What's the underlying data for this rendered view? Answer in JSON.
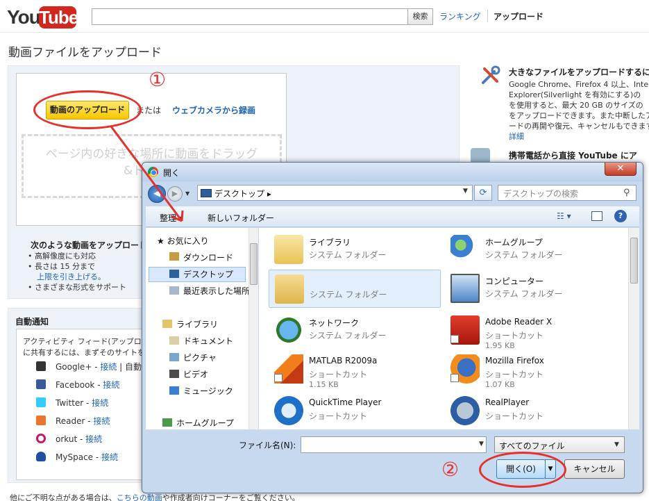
{
  "header": {
    "logo_you": "You",
    "logo_tube": "Tube",
    "search_value": "",
    "search_button": "検索",
    "nav_ranking": "ランキング",
    "nav_upload": "アップロード"
  },
  "page_title": "動画ファイルをアップロード",
  "upload": {
    "button": "動画のアップロード",
    "or_text": "または",
    "webcam_link": "ウェブカメラから録画",
    "drop_hint_line1": "ページ内の好きな場所に動画をドラッグ",
    "drop_hint_line2": "&ドロップ"
  },
  "requirements": {
    "title": "次のような動画をアップロード",
    "items": [
      "• 高解像度にも対応",
      "• 長さは 15 分まで",
      "上限を引き上げる。",
      "• さまざまな形式をサポート"
    ]
  },
  "notify": {
    "title": "自動通知",
    "desc_line1": "アクティビティ フィード(アップロード",
    "desc_line2": "に共有するには、まずそのサイトを",
    "services": [
      {
        "name": "Google+",
        "sep": " - ",
        "action": "接続",
        "extra": " | 自動通",
        "color": "#333333"
      },
      {
        "name": "Facebook",
        "sep": " - ",
        "action": "接続",
        "extra": "",
        "color": "#3b5998"
      },
      {
        "name": "Twitter",
        "sep": " - ",
        "action": "接続",
        "extra": "",
        "color": "#33ccff"
      },
      {
        "name": "Reader",
        "sep": " - ",
        "action": "接続",
        "extra": "",
        "color": "#e8762d"
      },
      {
        "name": "orkut",
        "sep": " - ",
        "action": "接続",
        "extra": "",
        "color": "#c4176c"
      },
      {
        "name": "MySpace",
        "sep": " - ",
        "action": "接続",
        "extra": "",
        "color": "#1e4fa1"
      }
    ]
  },
  "footer": {
    "prefix": "他にご不明な点がある場合は、",
    "link": "こちらの動画",
    "suffix": "や作成者向けコーナーをご覧ください。"
  },
  "tips": {
    "large_title": "大きなファイルをアップロードするに",
    "large_body": [
      "Google Chrome、Firefox 4 以上、Inter",
      "Explorer(Silverlight を有効にする)の",
      "を使用すると、最大 20 GB のサイズの",
      "をアップロードできます。また中断したア",
      "ードの再開や復元、キャンセルもできます",
      "詳細"
    ],
    "mobile_title": "携帯電話から直接 YouTube にア"
  },
  "annotations": {
    "step1": "①",
    "step2": "②"
  },
  "dialog": {
    "title": "開く",
    "close": "✕",
    "address": "デスクトップ ▸",
    "search_placeholder": "デスクトップの検索",
    "toolbar_organize": "整理 ▾",
    "toolbar_new_folder": "新しいフォルダー",
    "help": "?",
    "nav_items": [
      {
        "label": "★ お気に入り"
      },
      {
        "label": "ダウンロード"
      },
      {
        "label": "デスクトップ"
      },
      {
        "label": "最近表示した場所"
      },
      {
        "label": "ライブラリ"
      },
      {
        "label": "ドキュメント"
      },
      {
        "label": "ピクチャ"
      },
      {
        "label": "ビデオ"
      },
      {
        "label": "ミュージック"
      },
      {
        "label": "ホームグループ"
      }
    ],
    "files": [
      {
        "name": "ライブラリ",
        "type": "システム フォルダー",
        "size": ""
      },
      {
        "name": "ホームグループ",
        "type": "システム フォルダー",
        "size": ""
      },
      {
        "name": "",
        "type": "システム フォルダー",
        "size": ""
      },
      {
        "name": "コンピューター",
        "type": "システム フォルダー",
        "size": ""
      },
      {
        "name": "ネットワーク",
        "type": "システム フォルダー",
        "size": ""
      },
      {
        "name": "Adobe Reader X",
        "type": "ショートカット",
        "size": "1.95 KB"
      },
      {
        "name": "MATLAB R2009a",
        "type": "ショートカット",
        "size": "1.15 KB"
      },
      {
        "name": "Mozilla Firefox",
        "type": "ショートカット",
        "size": "1.07 KB"
      },
      {
        "name": "QuickTime Player",
        "type": "ショートカット",
        "size": ""
      },
      {
        "name": "RealPlayer",
        "type": "ショートカット",
        "size": ""
      }
    ],
    "filename_label": "ファイル名(N):",
    "filename_value": "",
    "filetype": "すべてのファイル",
    "open_button": "開く(O)",
    "cancel_button": "キャンセル"
  }
}
